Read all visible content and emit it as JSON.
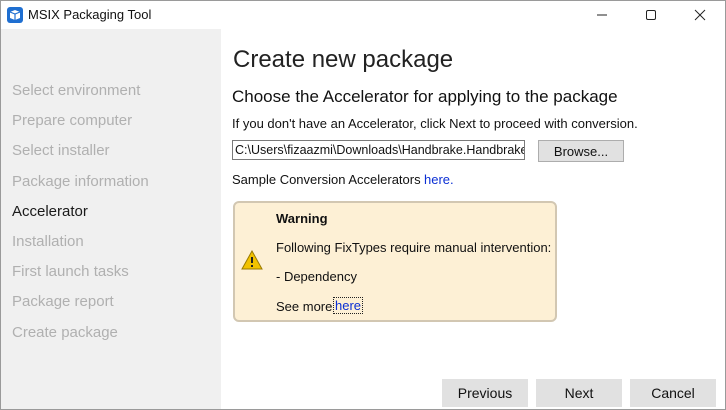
{
  "window": {
    "title": "MSIX Packaging Tool",
    "controls": [
      "minimize-icon",
      "maximize-icon",
      "close-icon"
    ]
  },
  "sidebar": {
    "items": [
      {
        "label": "Select environment",
        "state": "disabled"
      },
      {
        "label": "Prepare computer",
        "state": "disabled"
      },
      {
        "label": "Select installer",
        "state": "disabled"
      },
      {
        "label": "Package information",
        "state": "disabled"
      },
      {
        "label": "Accelerator",
        "state": "active"
      },
      {
        "label": "Installation",
        "state": "disabled"
      },
      {
        "label": "First launch tasks",
        "state": "disabled"
      },
      {
        "label": "Package report",
        "state": "disabled"
      },
      {
        "label": "Create package",
        "state": "disabled"
      }
    ]
  },
  "main": {
    "title": "Create new package",
    "subheading": "Choose the Accelerator for applying to the package",
    "info": "If you don't have an Accelerator, click Next to proceed with conversion.",
    "path_value": "C:\\Users\\fizaazmi\\Downloads\\Handbrake.Handbrake",
    "browse_label": "Browse...",
    "sample_label": "Sample Conversion Accelerators",
    "sample_link": "here."
  },
  "warning": {
    "icon": "warning-icon",
    "title": "Warning",
    "message": "Following FixTypes require manual intervention:",
    "item": "- Dependency",
    "see_more": "See more",
    "link": "here"
  },
  "footer": {
    "previous": "Previous",
    "next": "Next",
    "cancel": "Cancel"
  },
  "colors": {
    "sidebar_bg": "#f0f0f0",
    "warning_bg": "#fdf0d5",
    "link": "#0b2fd4",
    "button_bg": "#e1e1e1"
  }
}
